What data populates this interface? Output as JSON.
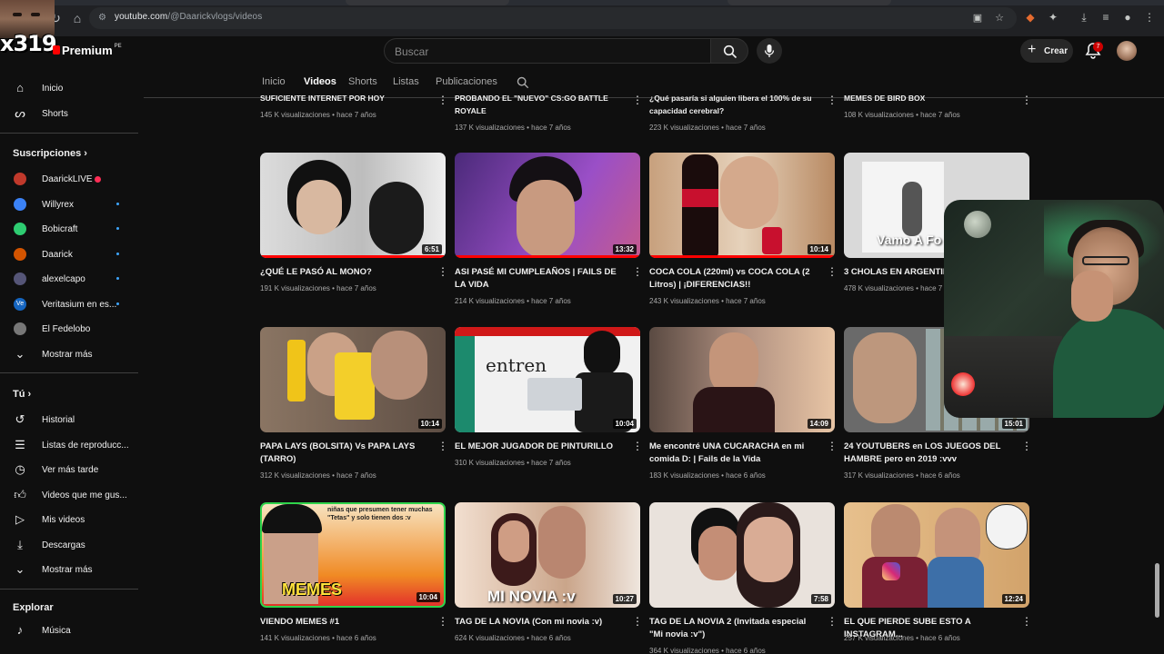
{
  "browser": {
    "url_host": "youtube.com",
    "url_path": "/@Daarickvlogs/videos"
  },
  "overlay": {
    "tag": "x319"
  },
  "header": {
    "brand": "Premium",
    "brand_region": "PE",
    "search_placeholder": "Buscar",
    "create_label": "Crear",
    "notification_count": "7"
  },
  "sidebar": {
    "main": [
      {
        "label": "Inicio",
        "icon": "home-icon"
      },
      {
        "label": "Shorts",
        "icon": "shorts-icon"
      }
    ],
    "subscriptions_title": "Suscripciones",
    "subscriptions": [
      {
        "label": "DaarickLIVE",
        "color": "#c0392b",
        "live": true
      },
      {
        "label": "Willyrex",
        "color": "#3b82f6"
      },
      {
        "label": "Bobicraft",
        "color": "#2ecc71"
      },
      {
        "label": "Daarick",
        "color": "#d35400"
      },
      {
        "label": "alexelcapo",
        "color": "#555577"
      },
      {
        "label": "Veritasium en es...",
        "color": "#1565c0",
        "abbr": "Ve"
      },
      {
        "label": "El Fedelobo",
        "color": "#777777"
      }
    ],
    "show_more": "Mostrar más",
    "you_title": "Tú",
    "you_items": [
      {
        "label": "Historial",
        "icon": "history-icon"
      },
      {
        "label": "Listas de reproducc...",
        "icon": "playlists-icon"
      },
      {
        "label": "Ver más tarde",
        "icon": "watch-later-icon"
      },
      {
        "label": "Videos que me gus...",
        "icon": "like-icon"
      },
      {
        "label": "Mis videos",
        "icon": "my-videos-icon"
      },
      {
        "label": "Descargas",
        "icon": "download-icon"
      },
      {
        "label": "Mostrar más",
        "icon": "chevron-down-icon"
      }
    ],
    "explore_title": "Explorar",
    "explore_items": [
      {
        "label": "Música",
        "icon": "music-icon"
      }
    ]
  },
  "tabs": [
    "Inicio",
    "Videos",
    "Shorts",
    "Listas",
    "Publicaciones"
  ],
  "active_tab": "Videos",
  "top_row": [
    {
      "title": "SUFICIENTE INTERNET POR HOY",
      "meta": "145 K visualizaciones • hace 7 años"
    },
    {
      "title": "PROBANDO EL \"NUEVO\" CS:GO BATTLE ROYALE",
      "meta": "137 K visualizaciones • hace 7 años"
    },
    {
      "title": "¿Qué pasaría si alguien libera el 100% de su capacidad cerebral?",
      "meta": "223 K visualizaciones • hace 7 años"
    },
    {
      "title": "MEMES DE BIRD BOX",
      "meta": "108 K visualizaciones • hace 7 años"
    }
  ],
  "videos": [
    {
      "title": "¿QUÉ LE PASÓ AL MONO?",
      "meta": "191 K visualizaciones • hace 7 años",
      "duration": "6:51",
      "bg": "#bdbdbd",
      "watched": 1.0
    },
    {
      "title": "ASI PASÉ MI CUMPLEAÑOS | FAILS DE LA VIDA",
      "meta": "214 K visualizaciones • hace 7 años",
      "duration": "13:32",
      "bg": "#7b3fb0",
      "watched": 1.0
    },
    {
      "title": "COCA COLA (220ml) vs COCA COLA (2 Litros) | ¡DIFERENCIAS!!",
      "meta": "243 K visualizaciones • hace 7 años",
      "duration": "10:14",
      "bg": "#b88a63",
      "watched": 1.0
    },
    {
      "title": "3 CHOLAS EN ARGENTINA",
      "meta": "478 K visualizaciones • hace 7",
      "duration": "",
      "bg": "#d9d9d9",
      "thumb_text": "Vamo A Fo",
      "watched": 0
    },
    {
      "title": "PAPA LAYS (BOLSITA) Vs PAPA LAYS (TARRO)",
      "meta": "312 K visualizaciones • hace 7 años",
      "duration": "10:14",
      "bg": "#6d5a4a",
      "watched": 0
    },
    {
      "title": "EL MEJOR JUGADOR DE PINTURILLO",
      "meta": "310 K visualizaciones • hace 7 años",
      "duration": "10:04",
      "bg": "#f1f1f1",
      "thumb_text": "entren",
      "watched": 0
    },
    {
      "title": "Me encontré UNA CUCARACHA en mi comida D: | Fails de la Vida",
      "meta": "183 K visualizaciones • hace 6 años",
      "duration": "14:09",
      "bg": "#8a6d5e",
      "watched": 0
    },
    {
      "title": "24 YOUTUBERS en LOS JUEGOS DEL HAMBRE pero en 2019 :vvv",
      "meta": "317 K visualizaciones • hace 6 años",
      "duration": "15:01",
      "bg": "#6a6a6a",
      "watched": 0
    },
    {
      "title": "VIENDO MEMES #1",
      "meta": "141 K visualizaciones • hace 6 años",
      "duration": "10:04",
      "bg": "#d98a2b",
      "thumb_text": "MEMES",
      "thumb_caption": "niñas que presumen tener muchas \"Tetas\" y solo tienen dos :v",
      "watched": 0
    },
    {
      "title": "TAG DE LA NOVIA (Con mi novia :v)",
      "meta": "624 K visualizaciones • hace 6 años",
      "duration": "10:27",
      "bg": "#caa58a",
      "thumb_text": "MI NOVIA :v",
      "watched": 0
    },
    {
      "title": "TAG DE LA NOVIA 2 (Invitada especial \"Mi novia :v\")",
      "meta": "364 K visualizaciones • hace 6 años",
      "duration": "7:58",
      "bg": "#e9e2dc",
      "watched": 0
    },
    {
      "title": "EL QUE PIERDE SUBE ESTO A INSTAGRAM...",
      "meta": "257 K visualizaciones • hace 6 años",
      "duration": "12:24",
      "bg": "#d2a36b",
      "watched": 0
    }
  ],
  "colors": {
    "background": "#0f0f0f",
    "accent_red": "#ff0000",
    "link_blue": "#3ea6ff"
  }
}
